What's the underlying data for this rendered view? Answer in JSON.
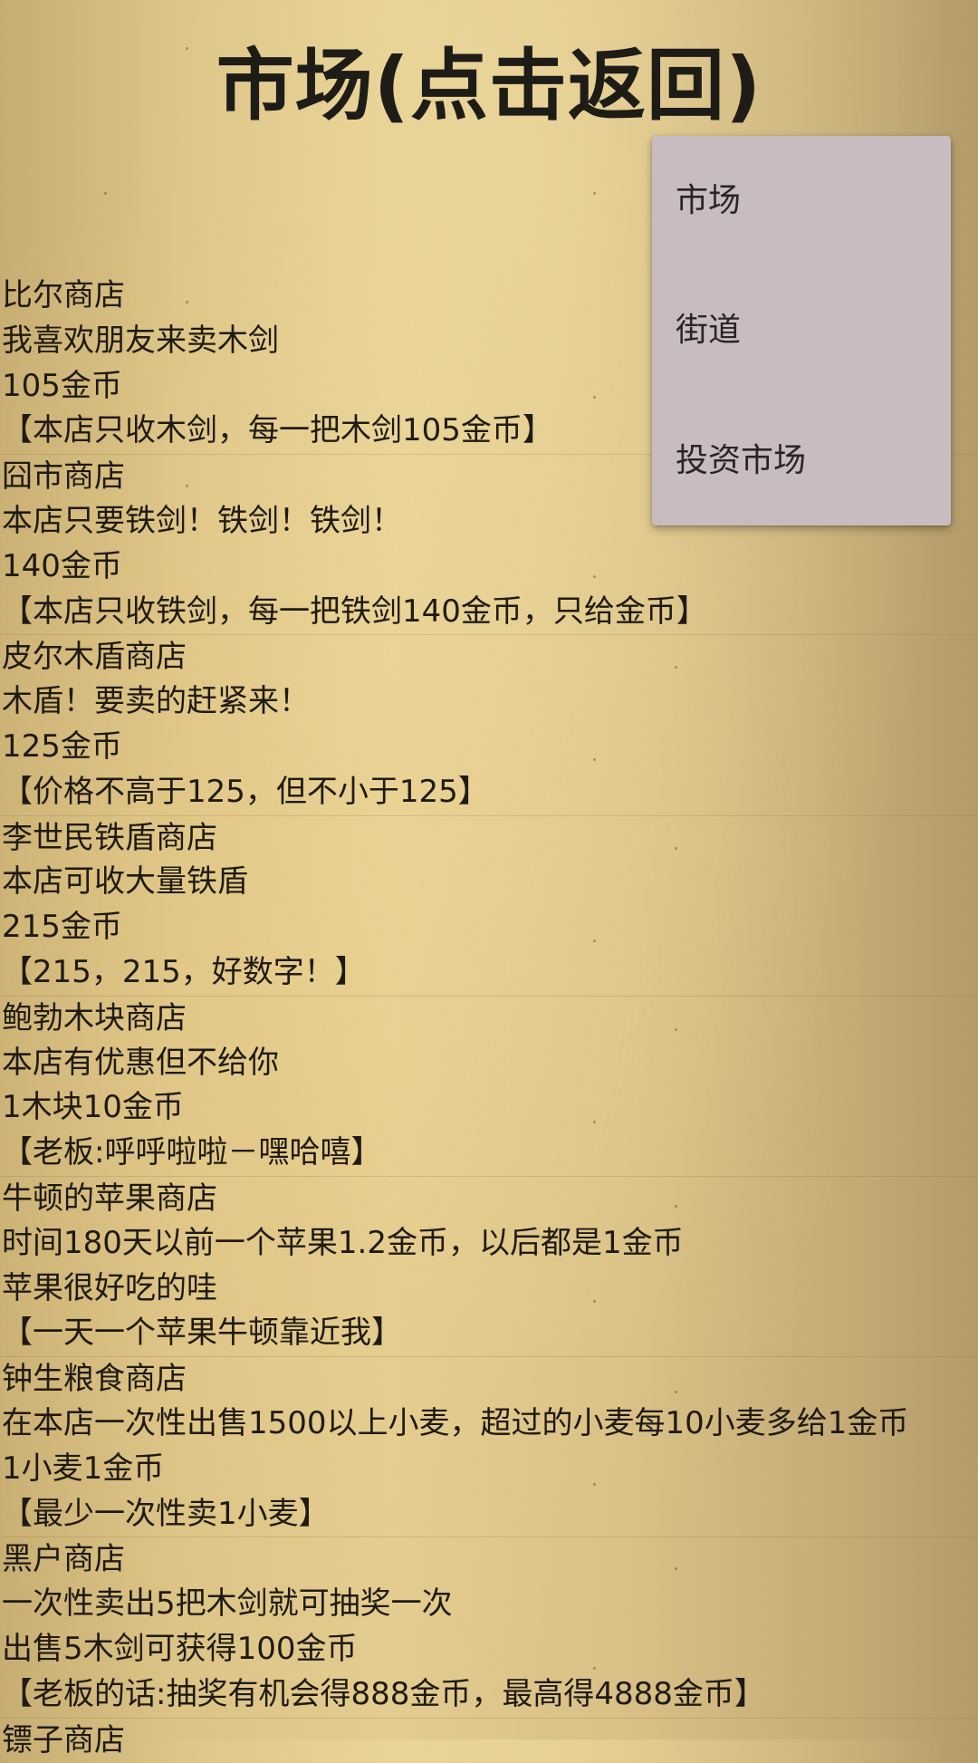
{
  "header": {
    "title": "市场(点击返回)"
  },
  "shops": [
    {
      "lines": [
        "比尔商店",
        "我喜欢朋友来卖木剑",
        "105金币",
        "【本店只收木剑，每一把木剑105金币】"
      ]
    },
    {
      "lines": [
        "囧市商店",
        "本店只要铁剑！铁剑！铁剑！",
        "140金币",
        "【本店只收铁剑，每一把铁剑140金币，只给金币】"
      ]
    },
    {
      "lines": [
        "皮尔木盾商店",
        "木盾！要卖的赶紧来！",
        "125金币",
        "【价格不高于125，但不小于125】"
      ]
    },
    {
      "lines": [
        "李世民铁盾商店",
        "本店可收大量铁盾",
        "215金币",
        "【215，215，好数字！】"
      ]
    },
    {
      "lines": [
        "鲍勃木块商店",
        "本店有优惠但不给你",
        "1木块10金币",
        "【老板:呼呼啦啦－嘿哈嘻】"
      ]
    },
    {
      "lines": [
        "牛顿的苹果商店",
        "时间180天以前一个苹果1.2金币，以后都是1金币",
        "苹果很好吃的哇",
        "【一天一个苹果牛顿靠近我】"
      ]
    },
    {
      "lines": [
        "钟生粮食商店",
        "在本店一次性出售1500以上小麦，超过的小麦每10小麦多给1金币",
        "1小麦1金币",
        "【最少一次性卖1小麦】"
      ]
    },
    {
      "lines": [
        "黑户商店",
        "一次性卖出5把木剑就可抽奖一次",
        "出售5木剑可获得100金币",
        "【老板的话:抽奖有机会得888金币，最高得4888金币】"
      ]
    },
    {
      "lines": [
        "镖子商店"
      ]
    }
  ],
  "menu": {
    "items": [
      "市场",
      "街道",
      "投资市场"
    ]
  },
  "colors": {
    "parchment": "#dbc386",
    "menu_bg": "#c8bcc0",
    "text": "#1f1b12"
  }
}
